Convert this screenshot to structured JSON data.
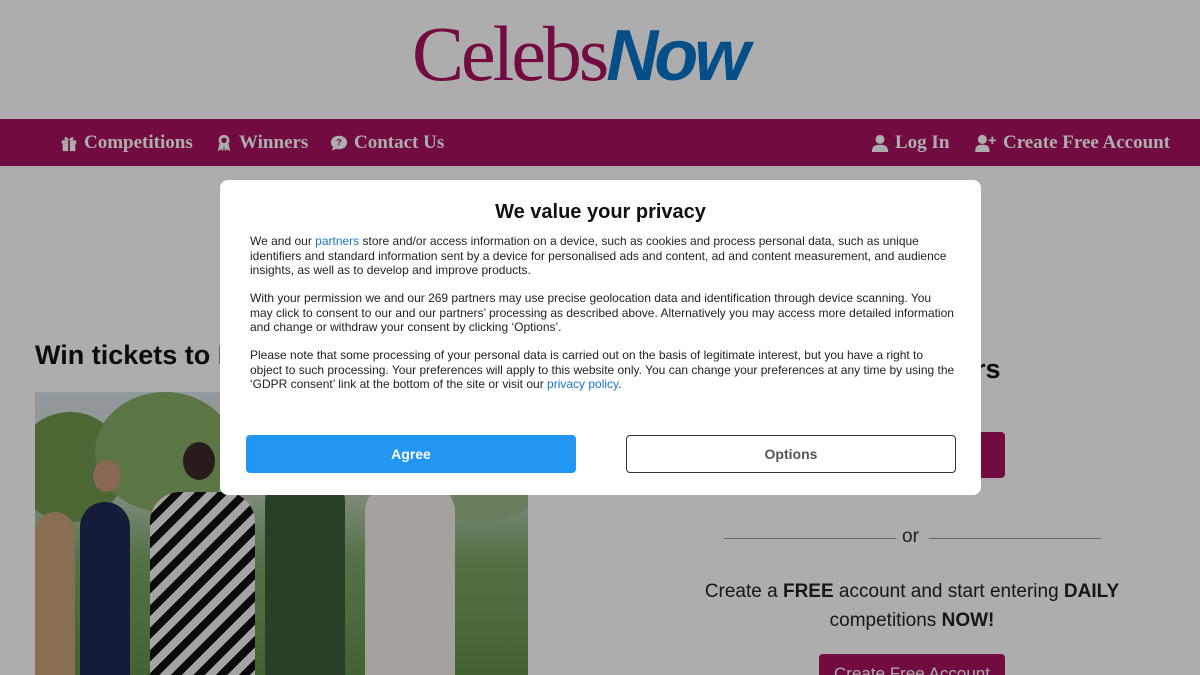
{
  "logo": {
    "part1": "Celebs",
    "part2": "Now"
  },
  "nav": {
    "competitions": "Competitions",
    "winners": "Winners",
    "contact": "Contact Us",
    "login": "Log In",
    "create_account": "Create Free Account"
  },
  "article": {
    "title_visible": "Win tickets to I"
  },
  "sidebar": {
    "heading_fragment": "ers",
    "or": "or",
    "create_line1_pre": "Create a ",
    "create_line1_bold1": "FREE",
    "create_line1_mid": " account and start entering ",
    "create_line1_bold2": "DAILY",
    "create_line2_pre": "competitions ",
    "create_line2_bold": "NOW!",
    "create_button": "Create Free Account"
  },
  "modal": {
    "title": "We value your privacy",
    "p1_pre": "We and our ",
    "p1_link": "partners",
    "p1_post": " store and/or access information on a device, such as cookies and process personal data, such as unique identifiers and standard information sent by a device for personalised ads and content, ad and content measurement, and audience insights, as well as to develop and improve products.",
    "p2": "With your permission we and our 269 partners may use precise geolocation data and identification through device scanning. You may click to consent to our and our partners’ processing as described above. Alternatively you may access more detailed information and change or withdraw your consent by clicking ‘Options’.",
    "p3_pre": "Please note that some processing of your personal data is carried out on the basis of legitimate interest, but you have a right to object to such processing. Your preferences will apply to this website only. You can change your preferences at any time by using the ‘GDPR consent’ link at the bottom of the site or visit our ",
    "p3_link": "privacy policy",
    "p3_post": ".",
    "agree": "Agree",
    "options": "Options"
  },
  "colors": {
    "brand_magenta": "#a8135f",
    "brand_blue": "#0a73c8",
    "agree_blue": "#2196f3",
    "link_blue": "#1a73c8"
  },
  "icons": [
    "gift-icon",
    "award-icon",
    "chat-icon",
    "user-icon",
    "user-plus-icon"
  ]
}
